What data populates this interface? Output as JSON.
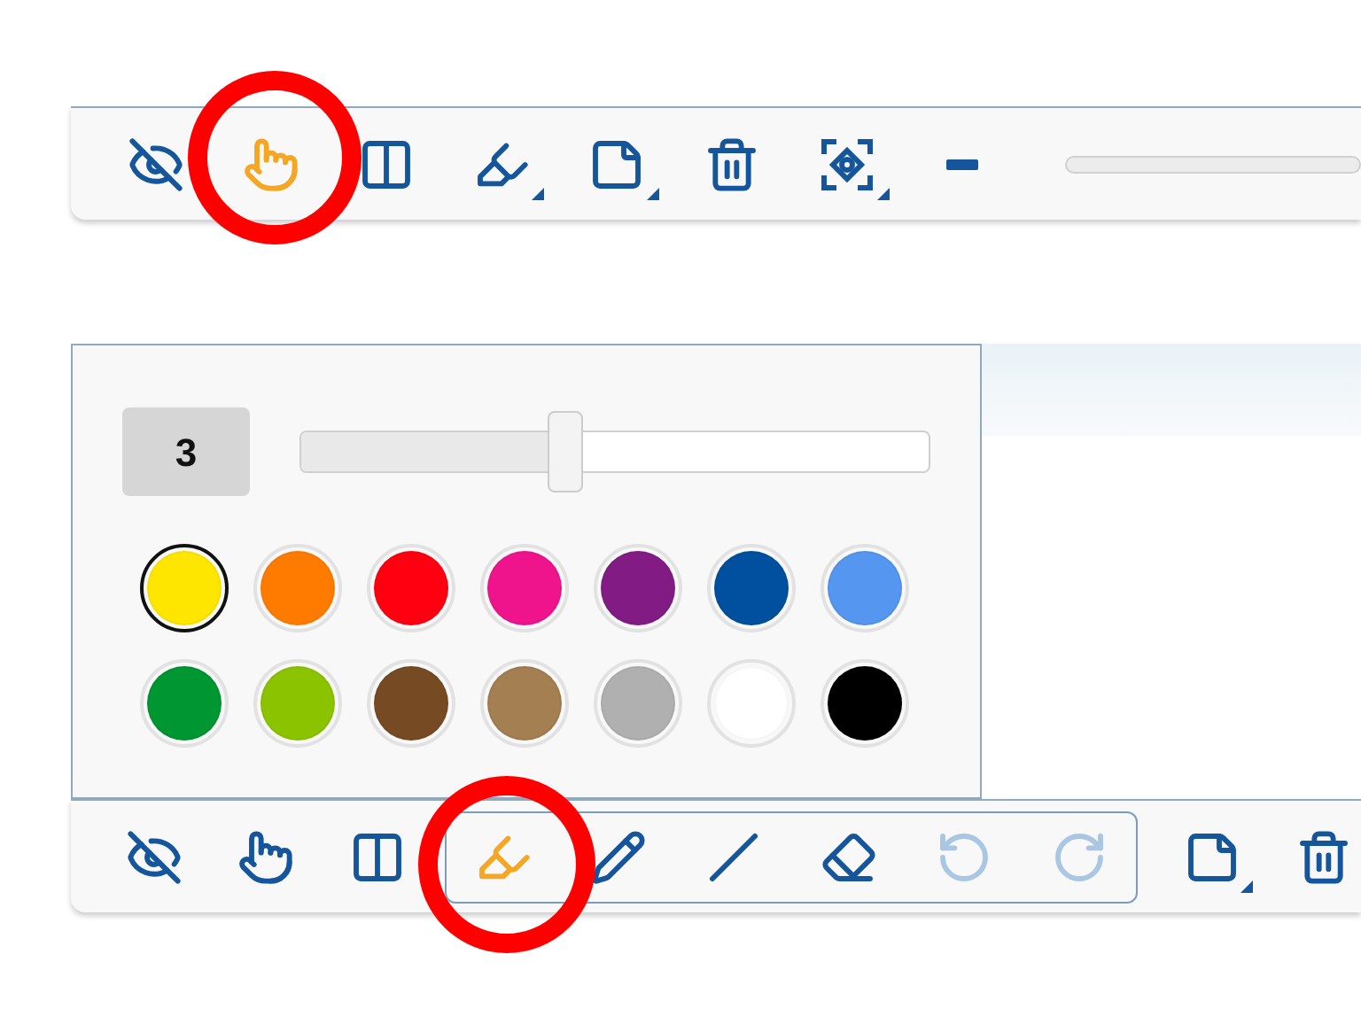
{
  "top_toolbar": {
    "tools": [
      {
        "kind": "hide-annotations",
        "selected": false,
        "has_menu": false
      },
      {
        "kind": "hand",
        "selected": true,
        "has_menu": false
      },
      {
        "kind": "split",
        "selected": false,
        "has_menu": false
      },
      {
        "kind": "highlighter",
        "selected": false,
        "has_menu": true
      },
      {
        "kind": "note",
        "selected": false,
        "has_menu": true
      },
      {
        "kind": "trash",
        "selected": false,
        "has_menu": false
      },
      {
        "kind": "fit",
        "selected": false,
        "has_menu": true
      },
      {
        "kind": "zoom-out",
        "selected": false,
        "has_menu": false
      }
    ]
  },
  "pen_panel": {
    "size": "3",
    "level": 0.42,
    "colors": [
      {
        "color": "#ffe600",
        "selected": true
      },
      {
        "color": "#ff7b00",
        "selected": false
      },
      {
        "color": "#ff0010",
        "selected": false
      },
      {
        "color": "#f0148c",
        "selected": false
      },
      {
        "color": "#821c84",
        "selected": false
      },
      {
        "color": "#00509f",
        "selected": false
      },
      {
        "color": "#5596f0",
        "selected": false
      },
      {
        "color": "#009632",
        "selected": false
      },
      {
        "color": "#8cc300",
        "selected": false
      },
      {
        "color": "#764b24",
        "selected": false
      },
      {
        "color": "#a37f52",
        "selected": false
      },
      {
        "color": "#b0b0b0",
        "selected": false
      },
      {
        "color": "#ffffff",
        "selected": false
      },
      {
        "color": "#000000",
        "selected": false
      }
    ]
  },
  "bottom_toolbar": {
    "tools_before": [
      {
        "kind": "hide-annotations",
        "selected": false,
        "disabled": false,
        "has_menu": false
      },
      {
        "kind": "hand",
        "selected": false,
        "disabled": false,
        "has_menu": false
      },
      {
        "kind": "split",
        "selected": false,
        "disabled": false,
        "has_menu": false
      }
    ],
    "drawing_tools": [
      {
        "kind": "highlighter",
        "selected": true,
        "disabled": false,
        "has_menu": false
      },
      {
        "kind": "pencil",
        "selected": false,
        "disabled": false,
        "has_menu": false
      },
      {
        "kind": "line",
        "selected": false,
        "disabled": false,
        "has_menu": false
      },
      {
        "kind": "eraser",
        "selected": false,
        "disabled": false,
        "has_menu": false
      },
      {
        "kind": "undo",
        "selected": false,
        "disabled": true,
        "has_menu": false
      },
      {
        "kind": "redo",
        "selected": false,
        "disabled": true,
        "has_menu": false
      }
    ],
    "tools_after": [
      {
        "kind": "note",
        "selected": false,
        "disabled": false,
        "has_menu": true
      },
      {
        "kind": "trash",
        "selected": false,
        "disabled": false,
        "has_menu": false
      }
    ]
  }
}
